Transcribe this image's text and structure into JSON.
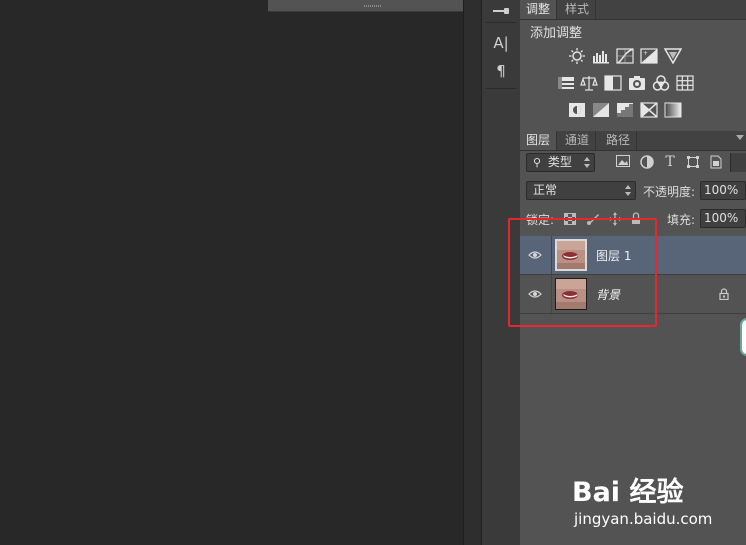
{
  "adjustments_panel": {
    "tabs": [
      {
        "label": "调整"
      },
      {
        "label": "样式"
      }
    ],
    "title": "添加调整",
    "icons_row1": [
      "brightness-contrast-icon",
      "levels-icon",
      "curves-icon",
      "exposure-icon",
      "vibrance-icon"
    ],
    "icons_row2": [
      "hue-saturation-icon",
      "color-balance-icon",
      "black-white-icon",
      "photo-filter-icon",
      "channel-mixer-icon",
      "color-lookup-icon"
    ],
    "icons_row3": [
      "invert-icon",
      "posterize-icon",
      "threshold-icon",
      "selective-color-icon",
      "gradient-map-icon"
    ]
  },
  "layers_panel": {
    "tabs": [
      {
        "label": "图层"
      },
      {
        "label": "通道"
      },
      {
        "label": "路径"
      }
    ],
    "filter": {
      "label": "类型",
      "icons": [
        "pixel-filter-icon",
        "adjustment-filter-icon",
        "type-filter-icon",
        "shape-filter-icon",
        "smart-object-filter-icon"
      ]
    },
    "blend_mode": "正常",
    "opacity_label": "不透明度:",
    "opacity_value": "100%",
    "lock_label": "锁定:",
    "fill_label": "填充:",
    "fill_value": "100%",
    "layers": [
      {
        "name": "图层 1",
        "selected": true,
        "visible": true,
        "locked": false
      },
      {
        "name": "背景",
        "selected": false,
        "visible": true,
        "locked": true
      }
    ]
  },
  "toolstrip": {
    "tools": [
      "brush-preset-icon",
      "character-icon",
      "paragraph-icon"
    ],
    "character_glyph": "A|",
    "paragraph_glyph": "¶"
  },
  "watermark": {
    "brand": "Bai 经验",
    "url": "jingyan.baidu.com"
  },
  "colors": {
    "selection_highlight": "#586478",
    "annotation_red": "#e8262c"
  }
}
